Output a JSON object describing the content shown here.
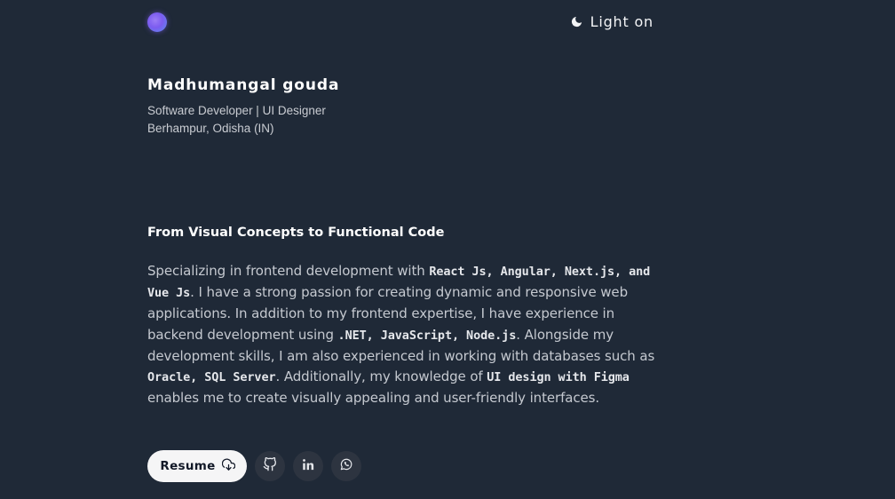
{
  "header": {
    "theme_toggle_label": "Light on",
    "theme_icon": "moon-icon",
    "logo_icon": "logo-dot-icon"
  },
  "intro": {
    "name": "Madhumangal gouda",
    "role": "Software Developer | UI Designer",
    "location": "Berhampur, Odisha (IN)"
  },
  "about": {
    "title": "From Visual Concepts to Functional Code",
    "body": {
      "p1": "Specializing in frontend development with ",
      "tech_frontend": "React Js, Angular, Next.js, and Vue Js",
      "p2": ". I have a strong passion for creating dynamic and responsive web applications. In addition to my frontend expertise, I have experience in backend development using ",
      "tech_backend": ".NET, JavaScript, Node.js",
      "p3": ". Alongside my development skills, I am also experienced in working with databases such as ",
      "tech_db": "Oracle, SQL Server",
      "p4": ". Additionally, my knowledge of ",
      "tech_design": "UI design with Figma",
      "p5": " enables me to create visually appealing and user-friendly interfaces."
    }
  },
  "actions": {
    "resume_label": "Resume",
    "resume_icon": "cloud-download-icon",
    "social_icons": [
      "github-icon",
      "linkedin-icon",
      "whatsapp-icon"
    ]
  },
  "colors": {
    "background": "#1f2937",
    "accent": "#7c5cf0",
    "button_bg": "#f5f5f6",
    "social_bg": "#2d3440"
  }
}
